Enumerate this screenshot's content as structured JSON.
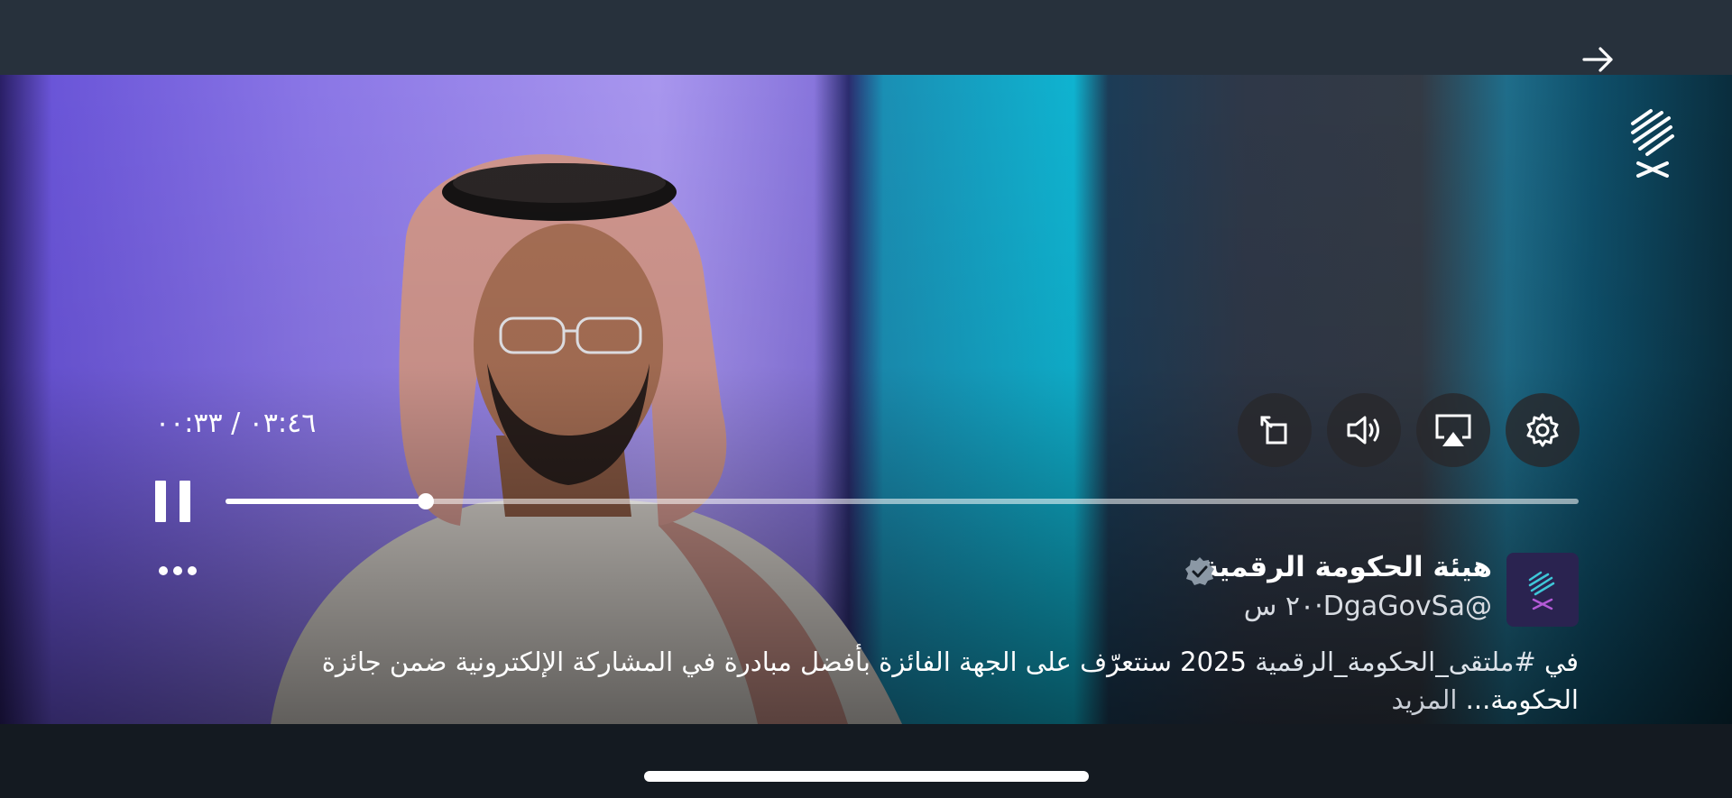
{
  "player": {
    "time_display": "٠٣:٤٦ / ٠٠:٣٣",
    "progress_fraction": 0.148,
    "controls": {
      "rotate_icon": "rotate-screen-icon",
      "volume_icon": "volume-icon",
      "airplay_icon": "airplay-icon",
      "settings_icon": "gear-icon"
    }
  },
  "account": {
    "name": "هيئة الحكومة الرقمية",
    "handle": "@DgaGovSa",
    "separator": "·",
    "time_ago": "٢٠ س",
    "verified": true
  },
  "caption": {
    "prefix": "في ",
    "hashtag": "#ملتقى_الحكومة_الرقمية",
    "body": " 2025 سنتعرّف على الجهة الفائزة بأفضل مبادرة في المشاركة الإلكترونية ضمن جائزة الحكومة...",
    "more_label": " المزيد"
  },
  "colors": {
    "top_bar": "#27313c",
    "bottom_bar": "#141a21",
    "verified_badge": "#8b98a5"
  }
}
